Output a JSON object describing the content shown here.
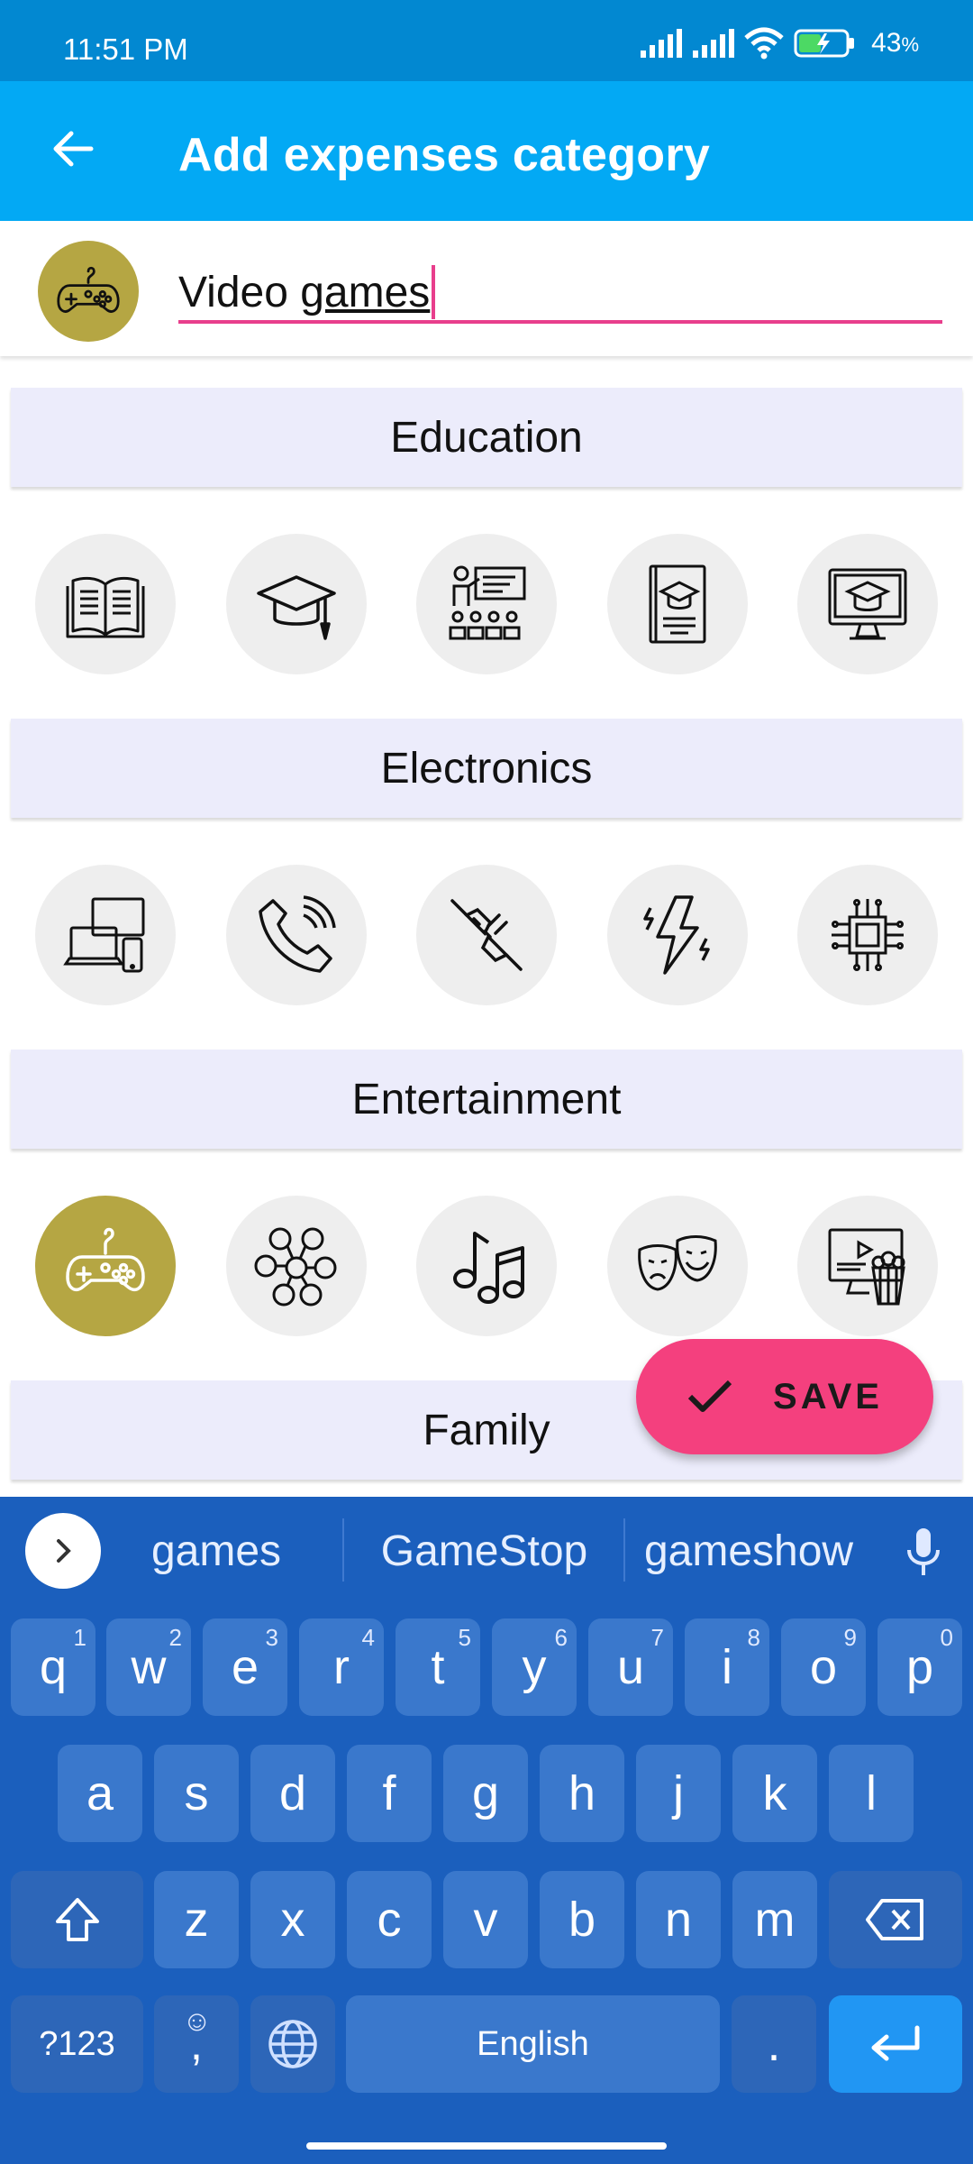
{
  "status_bar": {
    "time": "11:51 PM",
    "battery": "43",
    "battery_unit": "%"
  },
  "app_bar": {
    "title": "Add expenses category",
    "back_icon": "arrow-left-icon"
  },
  "name_field": {
    "value_plain": "Video ",
    "value_underlined": "games",
    "selected_icon": "gamepad-icon"
  },
  "categories": [
    {
      "name": "Education",
      "icons": [
        "open-book-icon",
        "graduation-cap-icon",
        "teacher-classroom-icon",
        "diploma-book-icon",
        "online-course-monitor-icon"
      ]
    },
    {
      "name": "Electronics",
      "icons": [
        "devices-icon",
        "phone-call-icon",
        "plug-cable-icon",
        "lightning-icon",
        "microchip-icon"
      ]
    },
    {
      "name": "Entertainment",
      "icons": [
        "gamepad-icon",
        "social-network-icon",
        "music-notes-icon",
        "theater-masks-icon",
        "movie-popcorn-icon"
      ],
      "selected_index": 0
    },
    {
      "name": "Family",
      "icons": []
    }
  ],
  "colors": {
    "status_bar": "#0288d1",
    "app_bar": "#03a9f4",
    "accent_pink": "#f4407e",
    "selected_icon_bg": "#b5a643",
    "category_header_bg": "#ececfb",
    "keyboard_bg": "#1b5fbd"
  },
  "save_button": {
    "label": "SAVE",
    "icon": "check-icon"
  },
  "keyboard": {
    "suggestions": [
      "games",
      "GameStop",
      "gameshow"
    ],
    "row1": [
      [
        "q",
        "1"
      ],
      [
        "w",
        "2"
      ],
      [
        "e",
        "3"
      ],
      [
        "r",
        "4"
      ],
      [
        "t",
        "5"
      ],
      [
        "y",
        "6"
      ],
      [
        "u",
        "7"
      ],
      [
        "i",
        "8"
      ],
      [
        "o",
        "9"
      ],
      [
        "p",
        "0"
      ]
    ],
    "row2": [
      "a",
      "s",
      "d",
      "f",
      "g",
      "h",
      "j",
      "k",
      "l"
    ],
    "row3": [
      "z",
      "x",
      "c",
      "v",
      "b",
      "n",
      "m"
    ],
    "symbols_key": "?123",
    "comma_key": ",",
    "emoji_hint": "☺",
    "space_label": "English",
    "period_key": "."
  }
}
